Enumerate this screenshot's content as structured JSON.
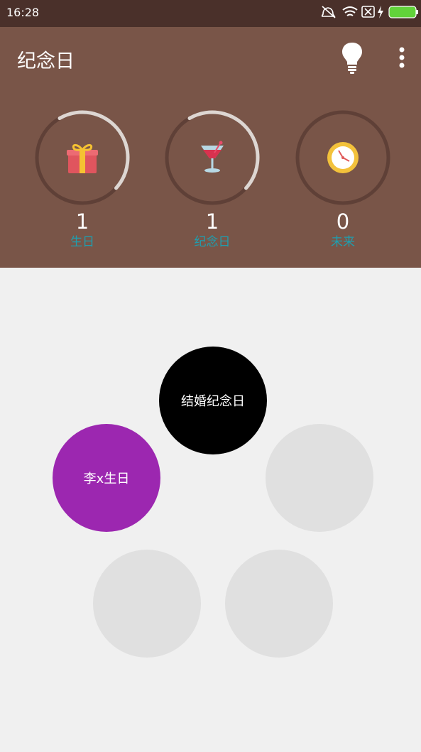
{
  "status_bar": {
    "time": "16:28",
    "icons": [
      "silent-icon",
      "wifi-icon",
      "sim-off-icon",
      "charging-icon",
      "battery-icon"
    ]
  },
  "app_bar": {
    "title": "纪念日",
    "icons": [
      "lightbulb-icon",
      "more-vert-icon"
    ]
  },
  "stats": [
    {
      "count": "1",
      "label": "生日",
      "icon": "gift-icon",
      "progress": 0.45
    },
    {
      "count": "1",
      "label": "纪念日",
      "icon": "cocktail-icon",
      "progress": 0.45
    },
    {
      "count": "0",
      "label": "未来",
      "icon": "clock-icon",
      "progress": 0
    }
  ],
  "events": [
    {
      "label": "结婚纪念日",
      "color": "#000000"
    },
    {
      "label": "李x生日",
      "color": "#9c27b0"
    },
    {
      "label": "",
      "color": "#e0e0e0"
    },
    {
      "label": "",
      "color": "#e0e0e0"
    },
    {
      "label": "",
      "color": "#e0e0e0"
    }
  ],
  "colors": {
    "header": "#795548",
    "status_bar": "#4a302a",
    "label_accent": "#1e9fb0",
    "background": "#f0f0f0"
  }
}
